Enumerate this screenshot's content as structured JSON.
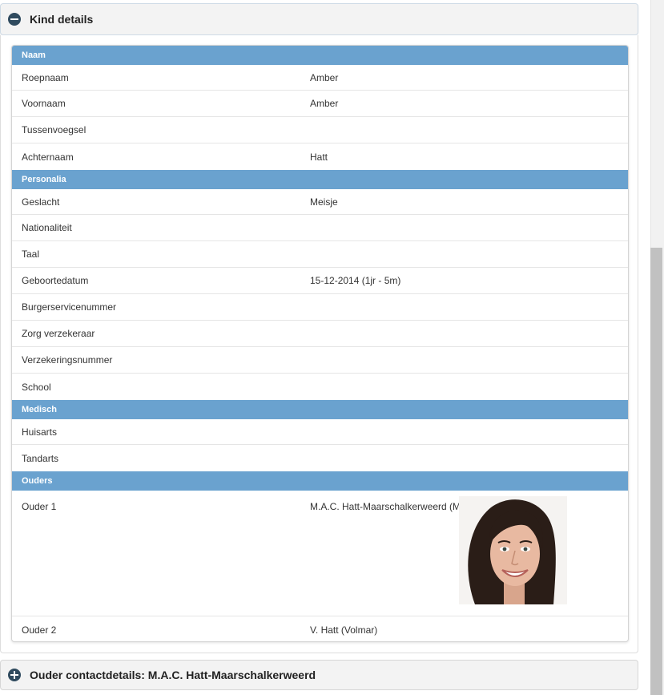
{
  "kind_panel": {
    "title": "Kind details",
    "sections": [
      {
        "heading": "Naam",
        "rows": [
          {
            "label": "Roepnaam",
            "value": "Amber"
          },
          {
            "label": "Voornaam",
            "value": "Amber"
          },
          {
            "label": "Tussenvoegsel",
            "value": ""
          },
          {
            "label": "Achternaam",
            "value": "Hatt"
          }
        ]
      },
      {
        "heading": "Personalia",
        "rows": [
          {
            "label": "Geslacht",
            "value": "Meisje"
          },
          {
            "label": "Nationaliteit",
            "value": ""
          },
          {
            "label": "Taal",
            "value": ""
          },
          {
            "label": "Geboortedatum",
            "value": "15-12-2014 (1jr - 5m)"
          },
          {
            "label": "Burgerservicenummer",
            "value": ""
          },
          {
            "label": "Zorg verzekeraar",
            "value": ""
          },
          {
            "label": "Verzekeringsnummer",
            "value": ""
          },
          {
            "label": "School",
            "value": ""
          }
        ]
      },
      {
        "heading": "Medisch",
        "rows": [
          {
            "label": "Huisarts",
            "value": ""
          },
          {
            "label": "Tandarts",
            "value": ""
          }
        ]
      },
      {
        "heading": "Ouders",
        "rows": [
          {
            "label": "Ouder 1",
            "value": "M.A.C. Hatt-Maarschalkerweerd (M",
            "photo": "parent-photo"
          },
          {
            "label": "Ouder 2",
            "value": "V. Hatt (Volmar)"
          }
        ]
      }
    ]
  },
  "contact_panel": {
    "title": "Ouder contactdetails: M.A.C. Hatt-Maarschalkerweerd"
  },
  "colors": {
    "section_heading_bg": "#6aa2cf",
    "toggle_icon": "#2f4a5e"
  },
  "icons": {
    "collapse": "minus-circle-icon",
    "expand": "plus-circle-icon"
  }
}
